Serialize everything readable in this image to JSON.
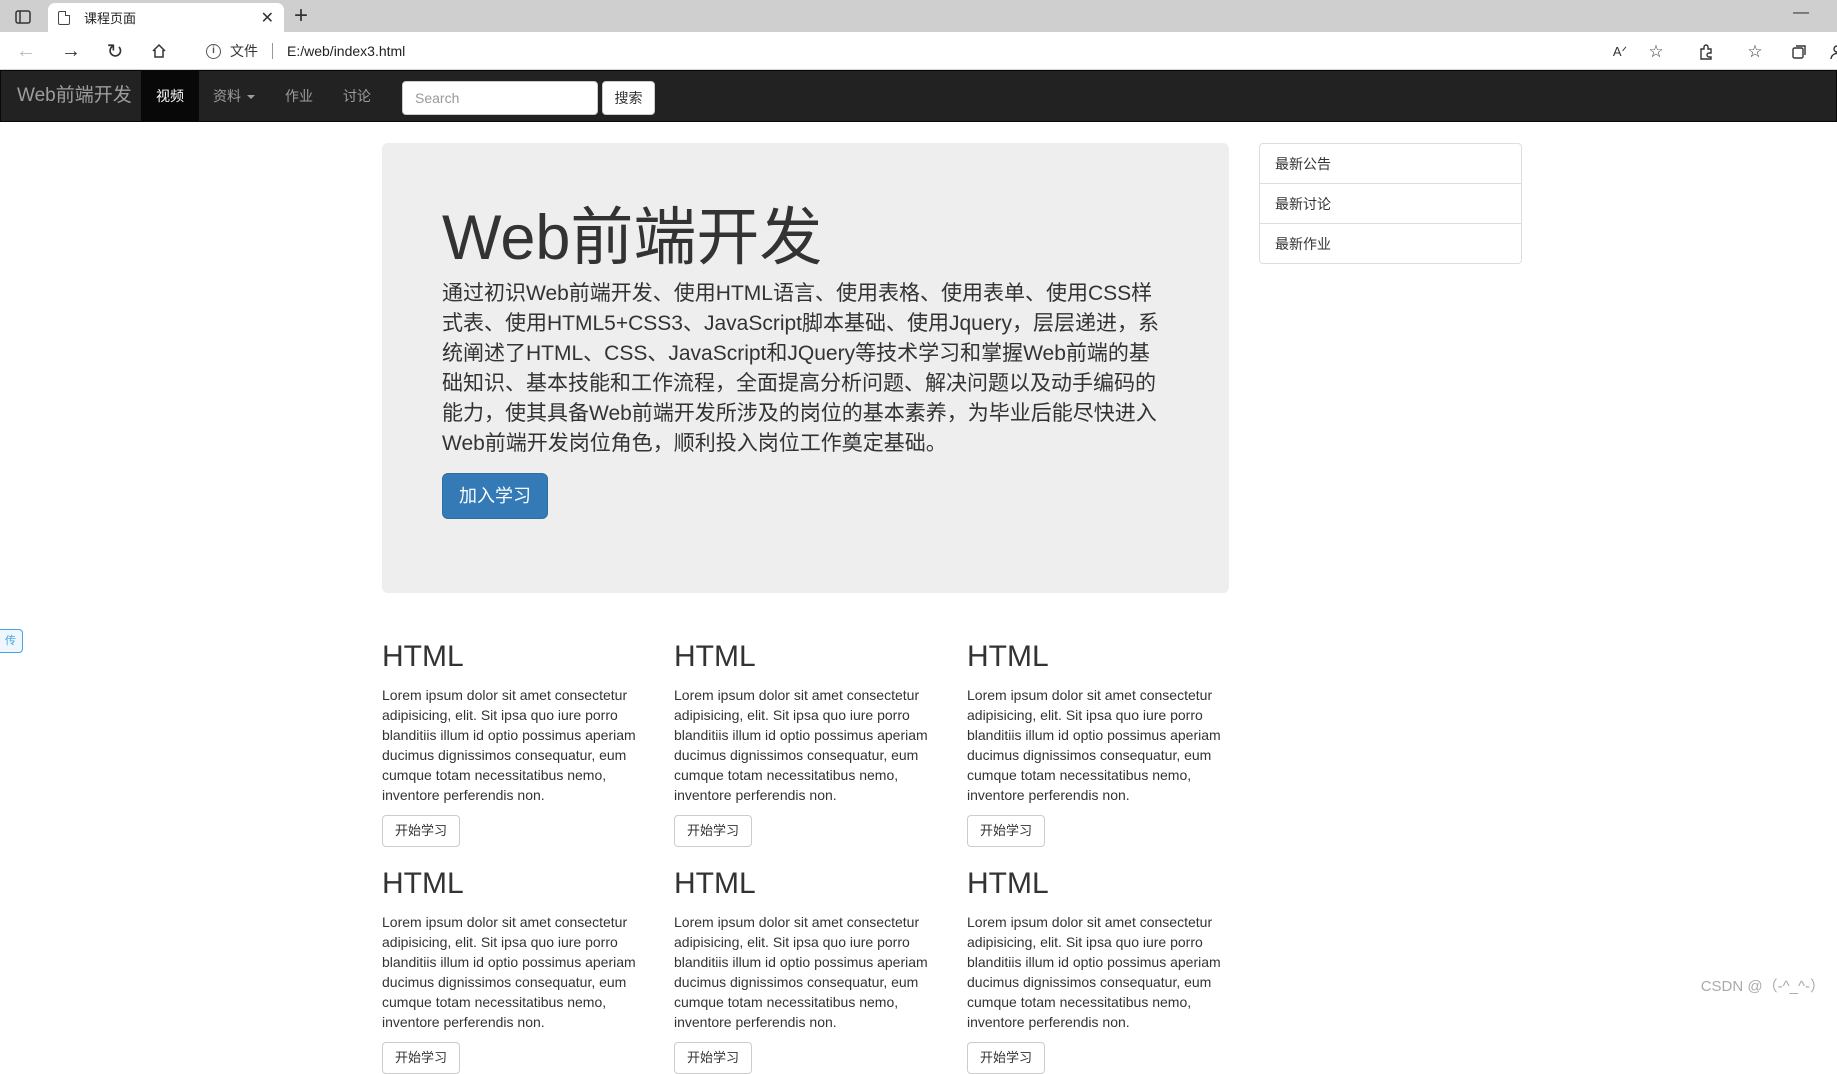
{
  "browser": {
    "tab_title": "课程页面",
    "address_scheme": "文件",
    "address_url": "E:/web/index3.html"
  },
  "navbar": {
    "brand": "Web前端开发",
    "items": [
      {
        "label": "视频",
        "active": true
      },
      {
        "label": "资料",
        "dropdown": true
      },
      {
        "label": "作业"
      },
      {
        "label": "讨论"
      }
    ],
    "search_placeholder": "Search",
    "search_button": "搜索"
  },
  "jumbotron": {
    "title": "Web前端开发",
    "text": "通过初识Web前端开发、使用HTML语言、使用表格、使用表单、使用CSS样式表、使用HTML5+CSS3、JavaScript脚本基础、使用Jquery，层层递进，系统阐述了HTML、CSS、JavaScript和JQuery等技术学习和掌握Web前端的基础知识、基本技能和工作流程，全面提高分析问题、解决问题以及动手编码的能力，使其具备Web前端开发所涉及的岗位的基本素养，为毕业后能尽快进入Web前端开发岗位角色，顺利投入岗位工作奠定基础。",
    "button": "加入学习"
  },
  "side_list": [
    "最新公告",
    "最新讨论",
    "最新作业"
  ],
  "cards": [
    {
      "title": "HTML",
      "text": "Lorem ipsum dolor sit amet consectetur adipisicing, elit. Sit ipsa quo iure porro blanditiis illum id optio possimus aperiam ducimus dignissimos consequatur, eum cumque totam necessitatibus nemo, inventore perferendis non.",
      "button": "开始学习"
    },
    {
      "title": "HTML",
      "text": "Lorem ipsum dolor sit amet consectetur adipisicing, elit. Sit ipsa quo iure porro blanditiis illum id optio possimus aperiam ducimus dignissimos consequatur, eum cumque totam necessitatibus nemo, inventore perferendis non.",
      "button": "开始学习"
    },
    {
      "title": "HTML",
      "text": "Lorem ipsum dolor sit amet consectetur adipisicing, elit. Sit ipsa quo iure porro blanditiis illum id optio possimus aperiam ducimus dignissimos consequatur, eum cumque totam necessitatibus nemo, inventore perferendis non.",
      "button": "开始学习"
    },
    {
      "title": "HTML",
      "text": "Lorem ipsum dolor sit amet consectetur adipisicing, elit. Sit ipsa quo iure porro blanditiis illum id optio possimus aperiam ducimus dignissimos consequatur, eum cumque totam necessitatibus nemo, inventore perferendis non.",
      "button": "开始学习"
    },
    {
      "title": "HTML",
      "text": "Lorem ipsum dolor sit amet consectetur adipisicing, elit. Sit ipsa quo iure porro blanditiis illum id optio possimus aperiam ducimus dignissimos consequatur, eum cumque totam necessitatibus nemo, inventore perferendis non.",
      "button": "开始学习"
    },
    {
      "title": "HTML",
      "text": "Lorem ipsum dolor sit amet consectetur adipisicing, elit. Sit ipsa quo iure porro blanditiis illum id optio possimus aperiam ducimus dignissimos consequatur, eum cumque totam necessitatibus nemo, inventore perferendis non.",
      "button": "开始学习"
    }
  ],
  "side_tag": "传",
  "watermark": "CSDN @（-^_^-）"
}
